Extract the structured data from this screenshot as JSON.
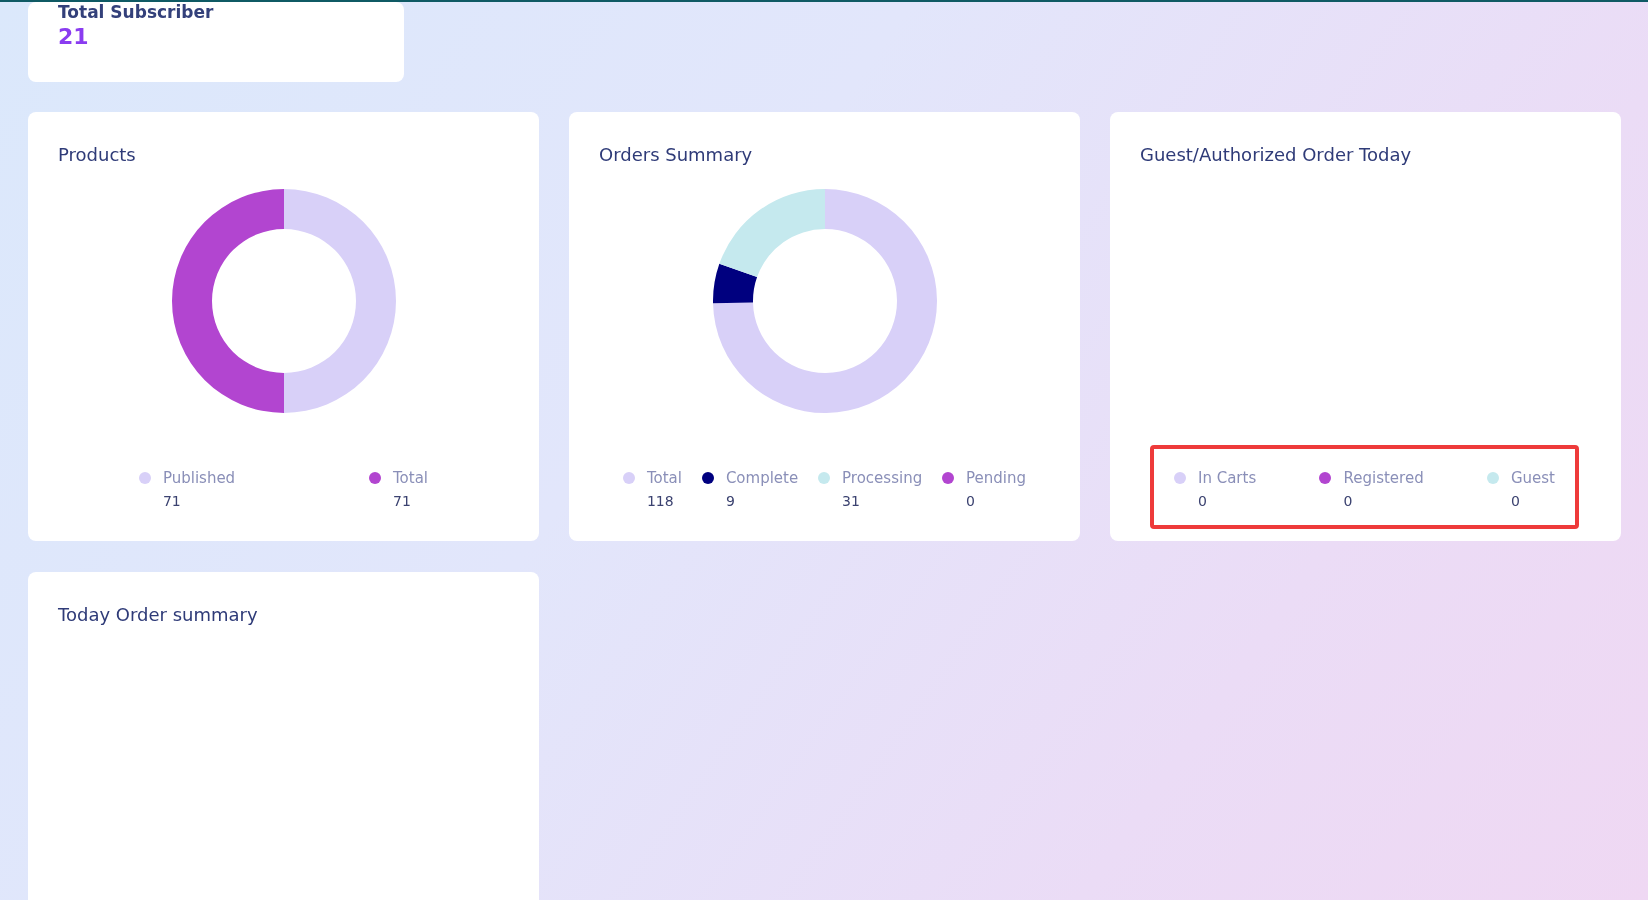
{
  "subscriber_card": {
    "title": "Total Subscriber",
    "value": "21"
  },
  "cards": [
    {
      "title": "Products",
      "highlighted": false,
      "legend": [
        {
          "color": "#d8d0f8"
        },
        {
          "color": "#b245d0"
        }
      ],
      "chart_data": {
        "type": "donut",
        "legend": "bottom",
        "categories": [
          "Published",
          "Total"
        ],
        "values": [
          71,
          71
        ],
        "value_labels": [
          "71",
          "71"
        ]
      }
    },
    {
      "title": "Orders Summary",
      "highlighted": false,
      "legend": [
        {
          "color": "#d8d0f8"
        },
        {
          "color": "#00007f"
        },
        {
          "color": "#c5e9ee"
        },
        {
          "color": "#b245d0"
        }
      ],
      "chart_data": {
        "type": "donut",
        "legend": "bottom",
        "categories": [
          "Total",
          "Complete",
          "Processing",
          "Pending"
        ],
        "values": [
          118,
          9,
          31,
          0
        ],
        "value_labels": [
          "118",
          "9",
          "31",
          "0"
        ]
      }
    },
    {
      "title": "Guest/Authorized Order Today",
      "highlighted": true,
      "legend": [
        {
          "label": "In Carts",
          "value": "0",
          "color": "#d8d0f8"
        },
        {
          "label": "Registered",
          "value": "0",
          "color": "#b245d0"
        },
        {
          "label": "Guest",
          "value": "0",
          "color": "#c5e9ee"
        }
      ]
    }
  ],
  "today_card": {
    "title": "Today Order summary"
  }
}
